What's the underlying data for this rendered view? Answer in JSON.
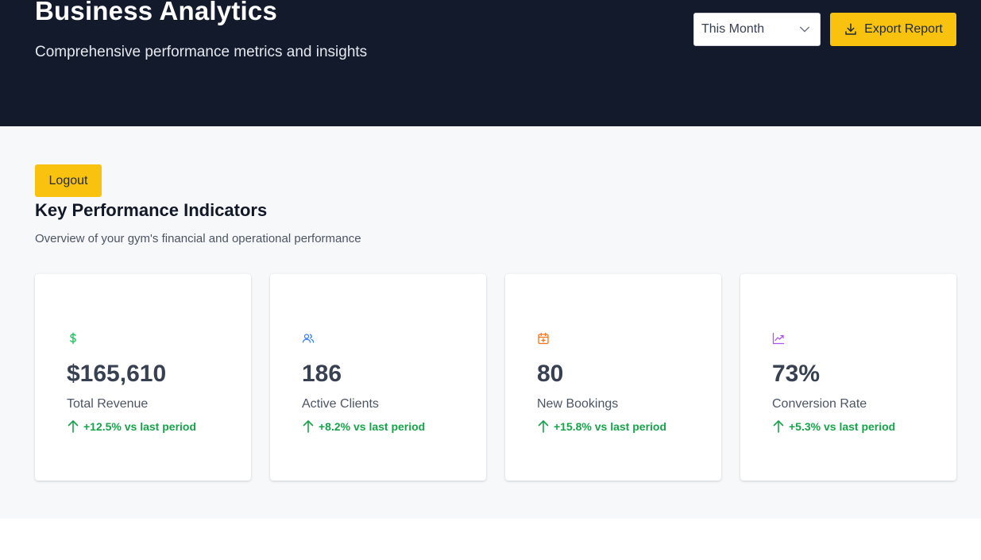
{
  "header": {
    "title": "Business Analytics",
    "subtitle": "Comprehensive performance metrics and insights",
    "period_select": {
      "value": "This Month"
    },
    "export_label": "Export Report",
    "background_color": "#121a2c",
    "accent_color": "#f9c20f"
  },
  "main": {
    "logout_label": "Logout",
    "section_title": "Key Performance Indicators",
    "section_subtitle": "Overview of your gym's financial and operational performance"
  },
  "kpis": [
    {
      "icon": "dollar-icon",
      "icon_color": "#22c55e",
      "value": "$165,610",
      "label": "Total Revenue",
      "trend": "+12.5% vs last period"
    },
    {
      "icon": "users-icon",
      "icon_color": "#3b82f6",
      "value": "186",
      "label": "Active Clients",
      "trend": "+8.2% vs last period"
    },
    {
      "icon": "calendar-plus-icon",
      "icon_color": "#f97316",
      "value": "80",
      "label": "New Bookings",
      "trend": "+15.8% vs last period"
    },
    {
      "icon": "trend-chart-icon",
      "icon_color": "#a855f7",
      "value": "73%",
      "label": "Conversion Rate",
      "trend": "+5.3% vs last period"
    }
  ],
  "trend_color": "#16a34a"
}
